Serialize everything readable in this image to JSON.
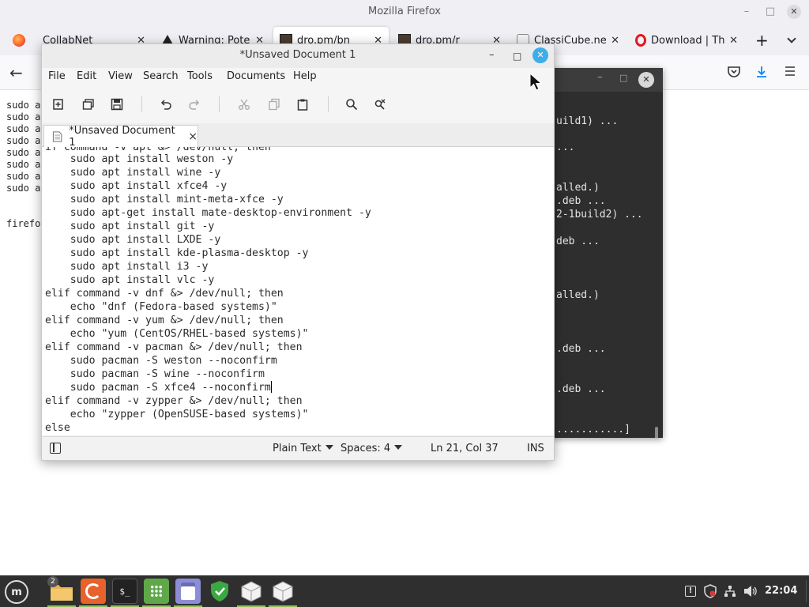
{
  "firefox": {
    "window_title": "Mozilla Firefox",
    "tabs": [
      {
        "label": "CollabNet",
        "icon": "firefox-icon"
      },
      {
        "label": "Warning: Poten",
        "icon": "warning-icon"
      },
      {
        "label": "dro.pm/bn",
        "icon": "image-thumb-icon"
      },
      {
        "label": "dro.pm/r",
        "icon": "image-thumb-icon"
      },
      {
        "label": "ClassiCube.net",
        "icon": "cube-icon"
      },
      {
        "label": "Download | The",
        "icon": "opera-icon"
      }
    ],
    "new_tab": "+",
    "page_lines": [
      "sudo a",
      "sudo a",
      "sudo a",
      "sudo a",
      "sudo a",
      "sudo a",
      "sudo a",
      "sudo a",
      "sudo a",
      "firefo"
    ]
  },
  "terminal": {
    "lines": [
      "uild1) ...",
      "...",
      "alled.)",
      ".deb ...",
      "2-1build2) ...",
      "deb ...",
      "alled.)",
      ".deb ...",
      ".deb ...",
      "...........]"
    ]
  },
  "editor": {
    "window_title": "*Unsaved Document 1",
    "menu": [
      "File",
      "Edit",
      "Search",
      "Tools",
      "Documents",
      "Help"
    ],
    "menu_view": "View",
    "tab_label": "*Unsaved Document 1",
    "tab_close": "×",
    "code": {
      "partial_top": "if command -v apt &> /dev/null; then",
      "lines": [
        "    sudo apt install weston -y",
        "    sudo apt install wine -y",
        "    sudo apt install xfce4 -y",
        "    sudo apt install mint-meta-xfce -y",
        "    sudo apt-get install mate-desktop-environment -y",
        "    sudo apt install git -y",
        "    sudo apt install LXDE -y",
        "    sudo apt install kde-plasma-desktop -y",
        "    sudo apt install i3 -y",
        "    sudo apt install vlc -y",
        "elif command -v dnf &> /dev/null; then",
        "    echo \"dnf (Fedora-based systems)\"",
        "elif command -v yum &> /dev/null; then",
        "    echo \"yum (CentOS/RHEL-based systems)\"",
        "elif command -v pacman &> /dev/null; then",
        "    sudo pacman -S weston --noconfirm",
        "    sudo pacman -S wine --noconfirm",
        "    sudo pacman -S xfce4 --noconfirm",
        "elif command -v zypper &> /dev/null; then",
        "    echo \"zypper (OpenSUSE-based systems)\"",
        "else"
      ]
    },
    "status": {
      "syntax": "Plain Text",
      "indent": "Spaces: 4",
      "position": "Ln 21, Col 37",
      "mode": "INS"
    }
  },
  "taskbar": {
    "badge_count": "2",
    "clock": "22:04"
  },
  "colors": {
    "close_accent": "#3daee9",
    "taskbar_bg": "#2f2f2f",
    "mint_green": "#8fbf5a"
  }
}
